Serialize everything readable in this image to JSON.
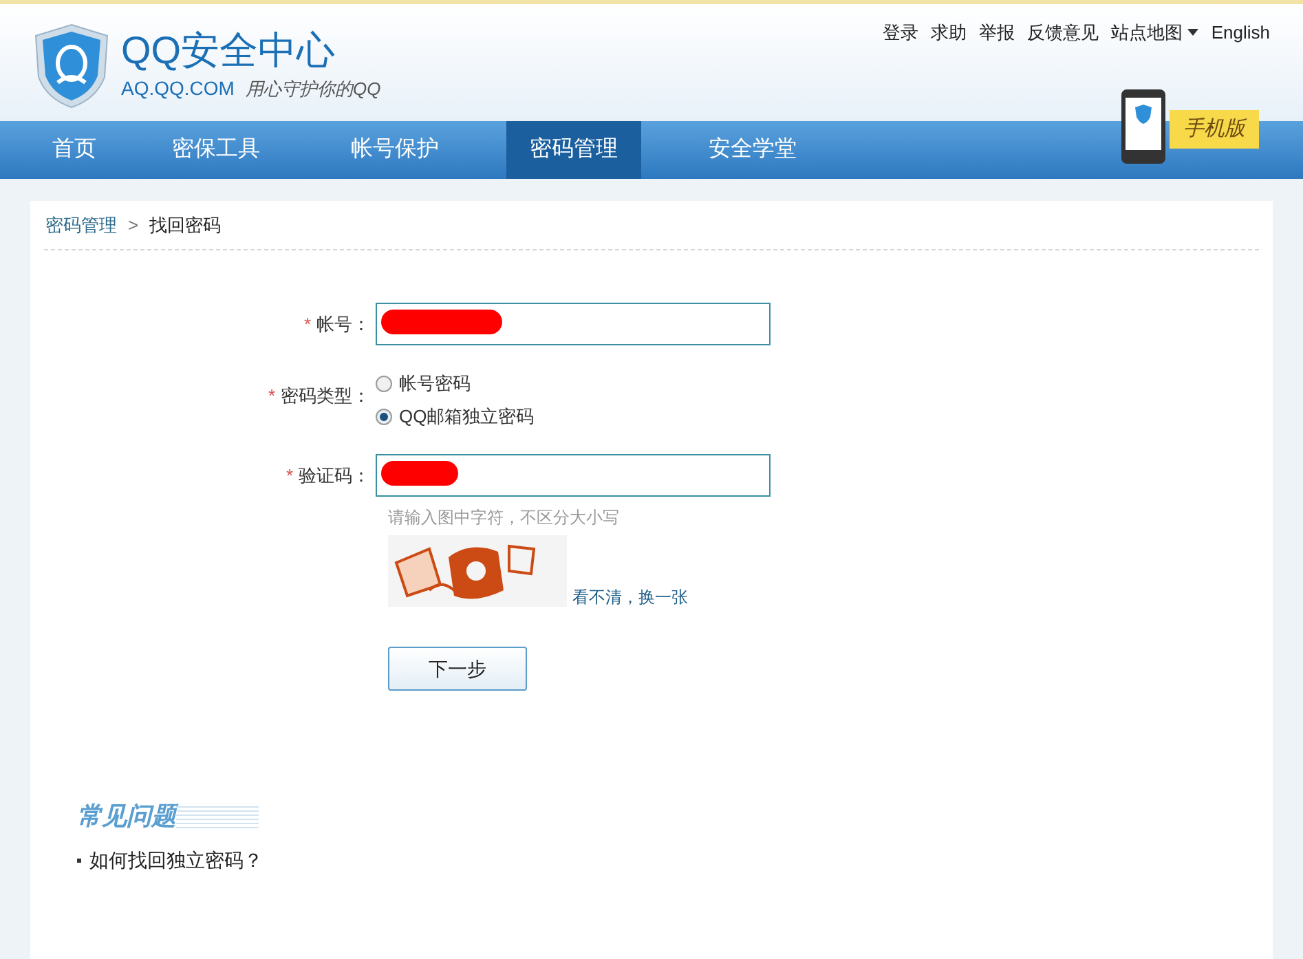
{
  "logo": {
    "title": "QQ安全中心",
    "domain": "AQ.QQ.COM",
    "slogan": "用心守护你的QQ"
  },
  "top_links": [
    {
      "label": "登录",
      "kind": "link"
    },
    {
      "label": "求助",
      "kind": "link"
    },
    {
      "label": "举报",
      "kind": "link"
    },
    {
      "label": "反馈意见",
      "kind": "link"
    },
    {
      "label": "站点地图",
      "kind": "dropdown"
    },
    {
      "label": "English",
      "kind": "link"
    }
  ],
  "nav": [
    {
      "label": "首页",
      "selected": false
    },
    {
      "label": "密保工具",
      "selected": false
    },
    {
      "label": "帐号保护",
      "selected": false
    },
    {
      "label": "密码管理",
      "selected": true
    },
    {
      "label": "安全学堂",
      "selected": false
    }
  ],
  "mobile_badge": "手机版",
  "breadcrumb": [
    "密码管理",
    ">",
    "找回密码"
  ],
  "form": {
    "account": {
      "label": "帐号：",
      "required_mark": "*"
    },
    "password_type": {
      "label": "密码类型：",
      "required_mark": "*",
      "options": [
        {
          "label": "帐号密码",
          "selected": false
        },
        {
          "label": "QQ邮箱独立密码",
          "selected": true
        }
      ]
    },
    "captcha": {
      "label": "验证码：",
      "required_mark": "*",
      "hint": "请输入图中字符，不区分大小写",
      "refresh_link": "看不清，换一张"
    },
    "next_button": "下一步"
  },
  "faq": {
    "title": "常见问题",
    "items": [
      "如何找回独立密码？"
    ]
  }
}
